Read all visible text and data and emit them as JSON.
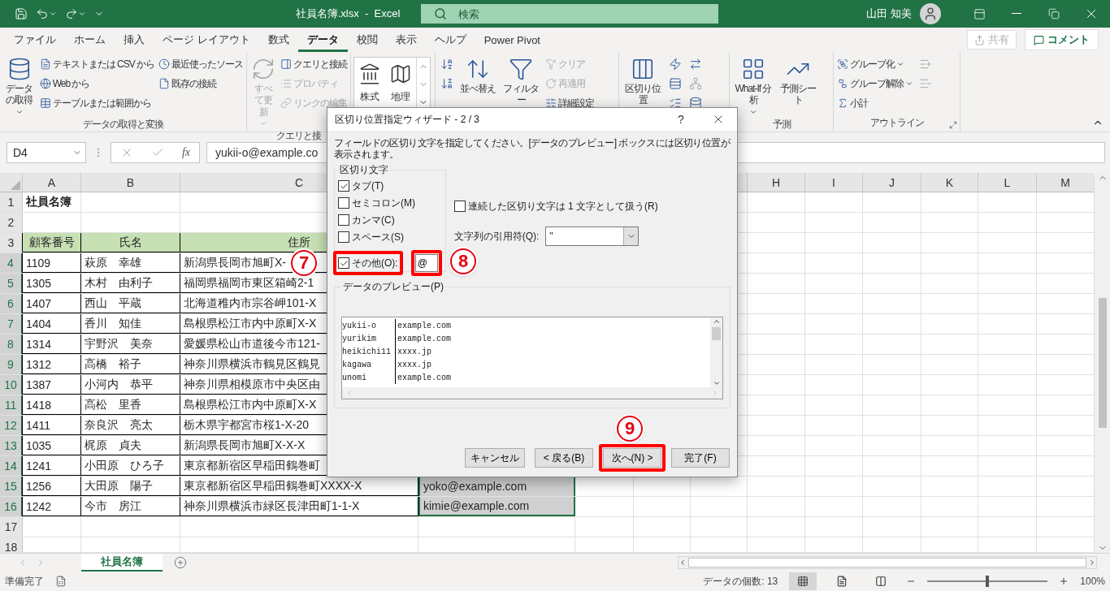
{
  "title_bar": {
    "title": "社員名簿.xlsx  -  Excel",
    "search": {
      "placeholder": "検索"
    },
    "user": "山田 知美"
  },
  "menu_tabs": [
    {
      "label": "ファイル",
      "selected": false
    },
    {
      "label": "ホーム",
      "selected": false
    },
    {
      "label": "挿入",
      "selected": false
    },
    {
      "label": "ページ レイアウト",
      "selected": false
    },
    {
      "label": "数式",
      "selected": false
    },
    {
      "label": "データ",
      "selected": true
    },
    {
      "label": "校閲",
      "selected": false
    },
    {
      "label": "表示",
      "selected": false
    },
    {
      "label": "ヘルプ",
      "selected": false
    },
    {
      "label": "Power Pivot",
      "selected": false
    }
  ],
  "share_button": {
    "label": "共有",
    "disabled": true
  },
  "comment_button": {
    "label": "コメント"
  },
  "ribbon": {
    "groups": [
      {
        "label": "データの取得と変換",
        "items": [
          {
            "kind": "large",
            "label": "データの取得",
            "disabled": false,
            "menu": true
          },
          {
            "kind": "small",
            "label": "テキストまたは CSV から",
            "disabled": false
          },
          {
            "kind": "small",
            "label": "Web から",
            "disabled": false
          },
          {
            "kind": "small",
            "label": "テーブルまたは範囲から",
            "disabled": false
          },
          {
            "kind": "small",
            "label": "最近使ったソース",
            "disabled": false
          },
          {
            "kind": "small",
            "label": "既存の接続",
            "disabled": false
          }
        ]
      },
      {
        "label": "クエリと接",
        "items": [
          {
            "kind": "large",
            "label": "すべて更新",
            "disabled": true,
            "menu": true
          },
          {
            "kind": "small",
            "label": "クエリと接続",
            "disabled": false
          },
          {
            "kind": "small",
            "label": "プロパティ",
            "disabled": true
          },
          {
            "kind": "small",
            "label": "リンクの編集",
            "disabled": true
          }
        ]
      },
      {
        "items": [
          {
            "kind": "gallery",
            "label": "株式",
            "disabled": false
          },
          {
            "kind": "gallery",
            "label": "地理",
            "disabled": false
          }
        ]
      },
      {
        "items": [
          {
            "kind": "icon",
            "disabled": false
          },
          {
            "kind": "icon",
            "disabled": false
          },
          {
            "kind": "large",
            "label": "並べ替え",
            "disabled": false
          },
          {
            "kind": "large",
            "label": "フィルター",
            "disabled": false
          },
          {
            "kind": "small",
            "label": "クリア",
            "disabled": true
          },
          {
            "kind": "small",
            "label": "再適用",
            "disabled": true
          },
          {
            "kind": "small",
            "label": "詳細設定",
            "disabled": false
          }
        ]
      },
      {
        "items": [
          {
            "kind": "large",
            "label": "区切り位置",
            "disabled": false
          },
          {
            "kind": "icon",
            "disabled": false
          },
          {
            "kind": "icon",
            "disabled": false
          },
          {
            "kind": "icon",
            "disabled": false
          },
          {
            "kind": "icon",
            "disabled": false
          },
          {
            "kind": "icon",
            "disabled": true
          },
          {
            "kind": "icon",
            "disabled": false
          }
        ]
      },
      {
        "label": "予測",
        "items": [
          {
            "kind": "large",
            "label": "What-If 分析",
            "disabled": false,
            "menu": true
          },
          {
            "kind": "large",
            "label": "予測シート",
            "disabled": false
          }
        ]
      },
      {
        "label": "アウトライン",
        "launcher": true,
        "items": [
          {
            "kind": "small",
            "label": "グループ化",
            "disabled": false,
            "menu": true
          },
          {
            "kind": "small",
            "label": "グループ解除",
            "disabled": false,
            "menu": true
          },
          {
            "kind": "small",
            "label": "小計",
            "disabled": false
          },
          {
            "kind": "icon",
            "disabled": true
          },
          {
            "kind": "icon",
            "disabled": true
          }
        ]
      }
    ]
  },
  "formula_bar": {
    "name_box": "D4",
    "function_label": "fx",
    "formula": "yukii-o@example.co"
  },
  "sheet": {
    "columns": [
      "A",
      "B",
      "C",
      "H",
      "I",
      "J",
      "K",
      "L",
      "M"
    ],
    "rows": [
      {
        "number": "1",
        "kind": "title",
        "selected": false,
        "cells": [
          "社員名簿"
        ]
      },
      {
        "number": "2",
        "kind": "blank",
        "selected": false
      },
      {
        "number": "3",
        "kind": "header",
        "selected": false,
        "cells": [
          "顧客番号",
          "氏名",
          "住所"
        ]
      },
      {
        "number": "4",
        "kind": "data",
        "selected": true,
        "cells": [
          "1109",
          "萩原　幸雄",
          "新潟県長岡市旭町X-"
        ]
      },
      {
        "number": "5",
        "kind": "data",
        "selected": true,
        "cells": [
          "1305",
          "木村　由利子",
          "福岡県福岡市東区箱崎2-1"
        ]
      },
      {
        "number": "6",
        "kind": "data",
        "selected": true,
        "cells": [
          "1407",
          "西山　平蔵",
          "北海道稚内市宗谷岬101-X"
        ]
      },
      {
        "number": "7",
        "kind": "data",
        "selected": true,
        "cells": [
          "1404",
          "香川　知佳",
          "島根県松江市内中原町X-X"
        ]
      },
      {
        "number": "8",
        "kind": "data",
        "selected": true,
        "cells": [
          "1314",
          "宇野沢　美奈",
          "愛媛県松山市道後今市121-"
        ]
      },
      {
        "number": "9",
        "kind": "data",
        "selected": true,
        "cells": [
          "1312",
          "高橋　裕子",
          "神奈川県横浜市鶴見区鶴見"
        ]
      },
      {
        "number": "10",
        "kind": "data",
        "selected": true,
        "cells": [
          "1387",
          "小河内　恭平",
          "神奈川県相模原市中央区由"
        ]
      },
      {
        "number": "11",
        "kind": "data",
        "selected": true,
        "cells": [
          "1418",
          "高松　里香",
          "島根県松江市内中原町X-X"
        ]
      },
      {
        "number": "12",
        "kind": "data",
        "selected": true,
        "cells": [
          "1411",
          "奈良沢　亮太",
          "栃木県宇都宮市桜1-X-20"
        ]
      },
      {
        "number": "13",
        "kind": "data",
        "selected": true,
        "cells": [
          "1035",
          "梶原　貞夫",
          "新潟県長岡市旭町X-X-X"
        ]
      },
      {
        "number": "14",
        "kind": "data",
        "selected": true,
        "cells": [
          "1241",
          "小田原　ひろ子",
          "東京都新宿区早稲田鶴巻町"
        ]
      },
      {
        "number": "15",
        "kind": "data",
        "selected": true,
        "cells": [
          "1256",
          "大田原　陽子",
          "東京都新宿区早稲田鶴巻町XXXX-X",
          "yoko@example.com"
        ]
      },
      {
        "number": "16",
        "kind": "data",
        "selected": true,
        "cells": [
          "1242",
          "今市　房江",
          "神奈川県横浜市緑区長津田町1-1-X",
          "kimie@example.com"
        ]
      },
      {
        "number": "17",
        "kind": "blank",
        "selected": false
      },
      {
        "number": "18",
        "kind": "blank",
        "selected": false
      }
    ]
  },
  "sheet_tabs": [
    {
      "label": "社員名簿",
      "selected": true
    }
  ],
  "status_bar": {
    "status": "準備完了",
    "count": "データの個数: 13",
    "zoom": {
      "level": 0.5,
      "reading": "100%"
    }
  },
  "dialog": {
    "title": "区切り位置指定ウィザード - 2 / 3",
    "help": "?",
    "instruction": "フィールドの区切り文字を指定してください。[データのプレビュー] ボックスには区切り位置が表示されます。",
    "delimiters": {
      "label": "区切り文字",
      "options": [
        {
          "label": "タブ(T)",
          "checked": true,
          "highlighted": false
        },
        {
          "label": "セミコロン(M)",
          "checked": false,
          "highlighted": false
        },
        {
          "label": "カンマ(C)",
          "checked": false,
          "highlighted": false
        },
        {
          "label": "スペース(S)",
          "checked": false,
          "highlighted": false
        },
        {
          "label": "その他(O):",
          "checked": true,
          "highlighted": true
        }
      ],
      "other_value": "@",
      "other_highlighted": true
    },
    "consecutive": {
      "label": "連続した区切り文字は 1 文字として扱う(R)",
      "checked": false
    },
    "qualifier": {
      "label": "文字列の引用符(Q):",
      "value": "\""
    },
    "preview": {
      "label": "データのプレビュー(P)",
      "rows": [
        [
          "yukii-o",
          "example.com"
        ],
        [
          "yurikim",
          "example.com"
        ],
        [
          "heikichi11",
          "xxxx.jp"
        ],
        [
          "kagawa",
          "xxxx.jp"
        ],
        [
          "unomi",
          "example.com"
        ]
      ]
    },
    "buttons": [
      {
        "label": "キャンセル",
        "highlighted": false
      },
      {
        "label": "< 戻る(B)",
        "highlighted": false
      },
      {
        "label": "次へ(N) >",
        "highlighted": true
      },
      {
        "label": "完了(F)",
        "highlighted": false
      }
    ]
  },
  "callouts": [
    "7",
    "8",
    "9"
  ]
}
